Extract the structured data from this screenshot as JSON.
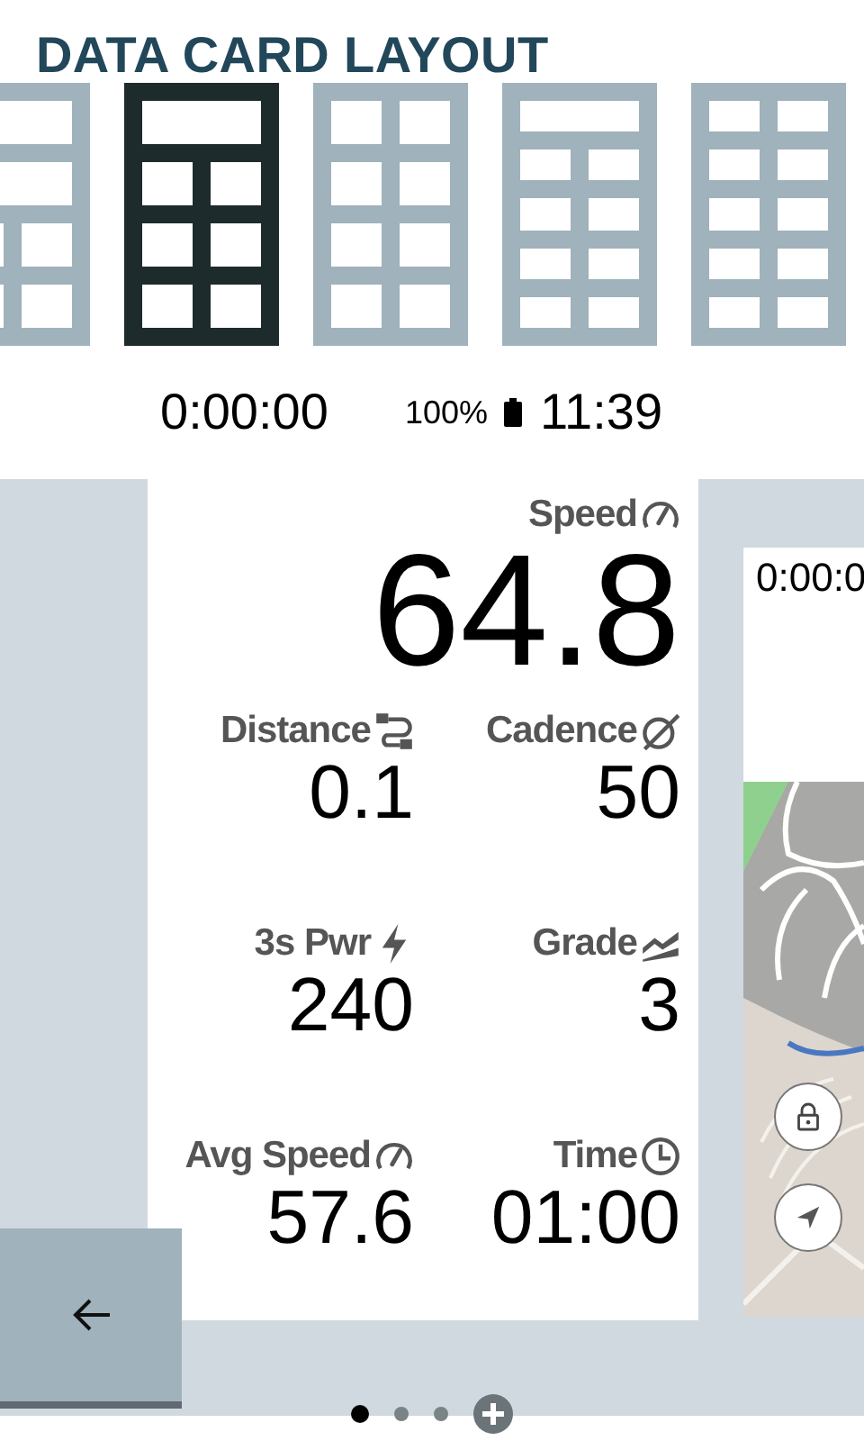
{
  "title": "DATA CARD LAYOUT",
  "layouts": [
    {
      "rows": [
        {
          "kind": "full"
        },
        {
          "kind": "full"
        },
        {
          "kind": "split"
        },
        {
          "kind": "split"
        }
      ],
      "selected": false
    },
    {
      "rows": [
        {
          "kind": "full"
        },
        {
          "kind": "split"
        },
        {
          "kind": "split"
        },
        {
          "kind": "split"
        }
      ],
      "selected": true
    },
    {
      "rows": [
        {
          "kind": "split"
        },
        {
          "kind": "split"
        },
        {
          "kind": "split"
        },
        {
          "kind": "split"
        }
      ],
      "selected": false
    },
    {
      "rows": [
        {
          "kind": "full"
        },
        {
          "kind": "split"
        },
        {
          "kind": "split"
        },
        {
          "kind": "split"
        },
        {
          "kind": "split"
        }
      ],
      "selected": false
    },
    {
      "rows": [
        {
          "kind": "split"
        },
        {
          "kind": "split"
        },
        {
          "kind": "split"
        },
        {
          "kind": "split"
        },
        {
          "kind": "split"
        }
      ],
      "selected": false
    }
  ],
  "status_bar": {
    "timer": "0:00:00",
    "battery": "100%",
    "clock": "11:39"
  },
  "fields": [
    {
      "kind": "speed",
      "label": "Speed",
      "value": "64.8",
      "wide": true
    },
    {
      "kind": "distance",
      "label": "Distance",
      "value": "0.1",
      "wide": false
    },
    {
      "kind": "cadence",
      "label": "Cadence",
      "value": "50",
      "wide": false
    },
    {
      "kind": "power",
      "label": "3s Pwr",
      "value": "240",
      "wide": false
    },
    {
      "kind": "grade",
      "label": "Grade",
      "value": "3",
      "wide": false
    },
    {
      "kind": "speed",
      "label": "Avg Speed",
      "value": "57.6",
      "wide": false
    },
    {
      "kind": "time",
      "label": "Time",
      "value": "01:00",
      "wide": false
    }
  ],
  "next_page": {
    "timer": "0:00:0"
  },
  "pages": [
    {
      "selected": true
    },
    {
      "selected": false
    },
    {
      "selected": false
    }
  ]
}
